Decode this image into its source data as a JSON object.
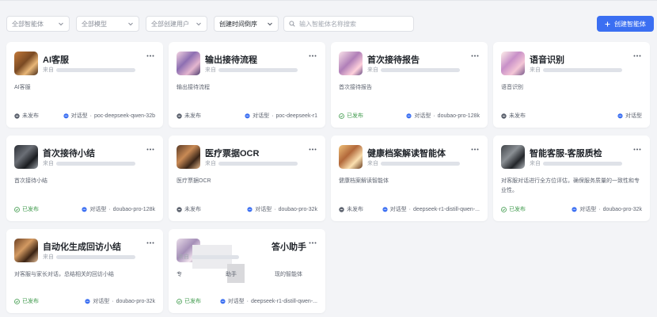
{
  "filters": {
    "agent_type": "全部智能体",
    "model": "全部模型",
    "creator": "全部创建用户",
    "sort": "创建时间倒序"
  },
  "search": {
    "placeholder": "输入智能体名称搜索"
  },
  "create_button": {
    "label": "创建智能体",
    "icon": "plus-icon"
  },
  "status_labels": {
    "unpublished": "未发布",
    "published": "已发布"
  },
  "colors": {
    "accent": "#3b6ff2",
    "published": "#3f9a4c",
    "unpublished": "#5f6571"
  },
  "cards": [
    {
      "title": "AI客服",
      "creator_prefix": "来自",
      "desc": "AI客服",
      "status": "未发布",
      "type": "对话型",
      "model": "poc-deepseek-qwen-32b"
    },
    {
      "title": "输出接待流程",
      "creator_prefix": "来自",
      "desc": "输出接待流程",
      "status": "未发布",
      "type": "对话型",
      "model": "poc-deepseek-r1"
    },
    {
      "title": "首次接待报告",
      "creator_prefix": "来自",
      "desc": "首次接待报告",
      "status": "已发布",
      "type": "对话型",
      "model": "doubao-pro-128k"
    },
    {
      "title": "语音识别",
      "creator_prefix": "来自",
      "desc": "语音识别",
      "status": "未发布",
      "type": "对话型",
      "model": ""
    },
    {
      "title": "首次接待小结",
      "creator_prefix": "来自",
      "desc": "首次接待小结",
      "status": "已发布",
      "type": "对话型",
      "model": "doubao-pro-128k"
    },
    {
      "title": "医疗票据OCR",
      "creator_prefix": "来自",
      "desc": "医疗票据OCR",
      "status": "未发布",
      "type": "对话型",
      "model": "doubao-pro-32k"
    },
    {
      "title": "健康档案解读智能体",
      "creator_prefix": "来自",
      "desc": "健康档案解读智能体",
      "status": "未发布",
      "type": "对话型",
      "model": "deepseek-r1-distill-qwen-..."
    },
    {
      "title": "智能客服-客服质检",
      "creator_prefix": "来自",
      "desc": "对客服对话进行全方位评估，确保服务质量的一致性和专业性。",
      "status": "已发布",
      "type": "对话型",
      "model": "doubao-pro-32k"
    },
    {
      "title": "自动化生成回访小结",
      "creator_prefix": "来自",
      "desc": "对客服与家长对话，总结相关的回访小结",
      "status": "已发布",
      "type": "对话型",
      "model": "doubao-pro-32k"
    },
    {
      "title": "答小助手",
      "creator_prefix": "来自",
      "desc_start": "专",
      "desc_mid": "助手",
      "desc_end": "现的智能体",
      "status": "已发布",
      "type": "对话型",
      "model": "deepseek-r1-distill-qwen-..."
    }
  ]
}
